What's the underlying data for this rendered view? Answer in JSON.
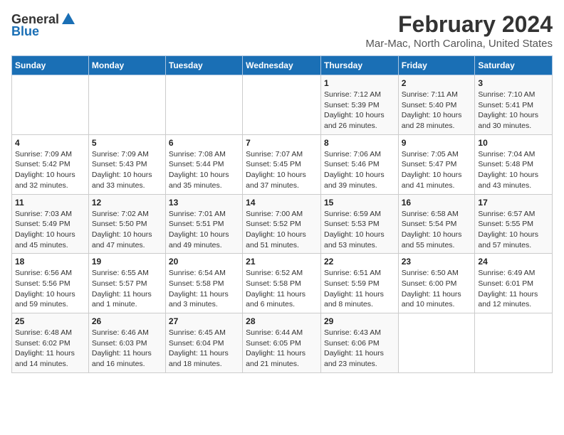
{
  "logo": {
    "general": "General",
    "blue": "Blue"
  },
  "header": {
    "month": "February 2024",
    "location": "Mar-Mac, North Carolina, United States"
  },
  "weekdays": [
    "Sunday",
    "Monday",
    "Tuesday",
    "Wednesday",
    "Thursday",
    "Friday",
    "Saturday"
  ],
  "weeks": [
    [
      {
        "day": "",
        "info": ""
      },
      {
        "day": "",
        "info": ""
      },
      {
        "day": "",
        "info": ""
      },
      {
        "day": "",
        "info": ""
      },
      {
        "day": "1",
        "info": "Sunrise: 7:12 AM\nSunset: 5:39 PM\nDaylight: 10 hours and 26 minutes."
      },
      {
        "day": "2",
        "info": "Sunrise: 7:11 AM\nSunset: 5:40 PM\nDaylight: 10 hours and 28 minutes."
      },
      {
        "day": "3",
        "info": "Sunrise: 7:10 AM\nSunset: 5:41 PM\nDaylight: 10 hours and 30 minutes."
      }
    ],
    [
      {
        "day": "4",
        "info": "Sunrise: 7:09 AM\nSunset: 5:42 PM\nDaylight: 10 hours and 32 minutes."
      },
      {
        "day": "5",
        "info": "Sunrise: 7:09 AM\nSunset: 5:43 PM\nDaylight: 10 hours and 33 minutes."
      },
      {
        "day": "6",
        "info": "Sunrise: 7:08 AM\nSunset: 5:44 PM\nDaylight: 10 hours and 35 minutes."
      },
      {
        "day": "7",
        "info": "Sunrise: 7:07 AM\nSunset: 5:45 PM\nDaylight: 10 hours and 37 minutes."
      },
      {
        "day": "8",
        "info": "Sunrise: 7:06 AM\nSunset: 5:46 PM\nDaylight: 10 hours and 39 minutes."
      },
      {
        "day": "9",
        "info": "Sunrise: 7:05 AM\nSunset: 5:47 PM\nDaylight: 10 hours and 41 minutes."
      },
      {
        "day": "10",
        "info": "Sunrise: 7:04 AM\nSunset: 5:48 PM\nDaylight: 10 hours and 43 minutes."
      }
    ],
    [
      {
        "day": "11",
        "info": "Sunrise: 7:03 AM\nSunset: 5:49 PM\nDaylight: 10 hours and 45 minutes."
      },
      {
        "day": "12",
        "info": "Sunrise: 7:02 AM\nSunset: 5:50 PM\nDaylight: 10 hours and 47 minutes."
      },
      {
        "day": "13",
        "info": "Sunrise: 7:01 AM\nSunset: 5:51 PM\nDaylight: 10 hours and 49 minutes."
      },
      {
        "day": "14",
        "info": "Sunrise: 7:00 AM\nSunset: 5:52 PM\nDaylight: 10 hours and 51 minutes."
      },
      {
        "day": "15",
        "info": "Sunrise: 6:59 AM\nSunset: 5:53 PM\nDaylight: 10 hours and 53 minutes."
      },
      {
        "day": "16",
        "info": "Sunrise: 6:58 AM\nSunset: 5:54 PM\nDaylight: 10 hours and 55 minutes."
      },
      {
        "day": "17",
        "info": "Sunrise: 6:57 AM\nSunset: 5:55 PM\nDaylight: 10 hours and 57 minutes."
      }
    ],
    [
      {
        "day": "18",
        "info": "Sunrise: 6:56 AM\nSunset: 5:56 PM\nDaylight: 10 hours and 59 minutes."
      },
      {
        "day": "19",
        "info": "Sunrise: 6:55 AM\nSunset: 5:57 PM\nDaylight: 11 hours and 1 minute."
      },
      {
        "day": "20",
        "info": "Sunrise: 6:54 AM\nSunset: 5:58 PM\nDaylight: 11 hours and 3 minutes."
      },
      {
        "day": "21",
        "info": "Sunrise: 6:52 AM\nSunset: 5:58 PM\nDaylight: 11 hours and 6 minutes."
      },
      {
        "day": "22",
        "info": "Sunrise: 6:51 AM\nSunset: 5:59 PM\nDaylight: 11 hours and 8 minutes."
      },
      {
        "day": "23",
        "info": "Sunrise: 6:50 AM\nSunset: 6:00 PM\nDaylight: 11 hours and 10 minutes."
      },
      {
        "day": "24",
        "info": "Sunrise: 6:49 AM\nSunset: 6:01 PM\nDaylight: 11 hours and 12 minutes."
      }
    ],
    [
      {
        "day": "25",
        "info": "Sunrise: 6:48 AM\nSunset: 6:02 PM\nDaylight: 11 hours and 14 minutes."
      },
      {
        "day": "26",
        "info": "Sunrise: 6:46 AM\nSunset: 6:03 PM\nDaylight: 11 hours and 16 minutes."
      },
      {
        "day": "27",
        "info": "Sunrise: 6:45 AM\nSunset: 6:04 PM\nDaylight: 11 hours and 18 minutes."
      },
      {
        "day": "28",
        "info": "Sunrise: 6:44 AM\nSunset: 6:05 PM\nDaylight: 11 hours and 21 minutes."
      },
      {
        "day": "29",
        "info": "Sunrise: 6:43 AM\nSunset: 6:06 PM\nDaylight: 11 hours and 23 minutes."
      },
      {
        "day": "",
        "info": ""
      },
      {
        "day": "",
        "info": ""
      }
    ]
  ]
}
